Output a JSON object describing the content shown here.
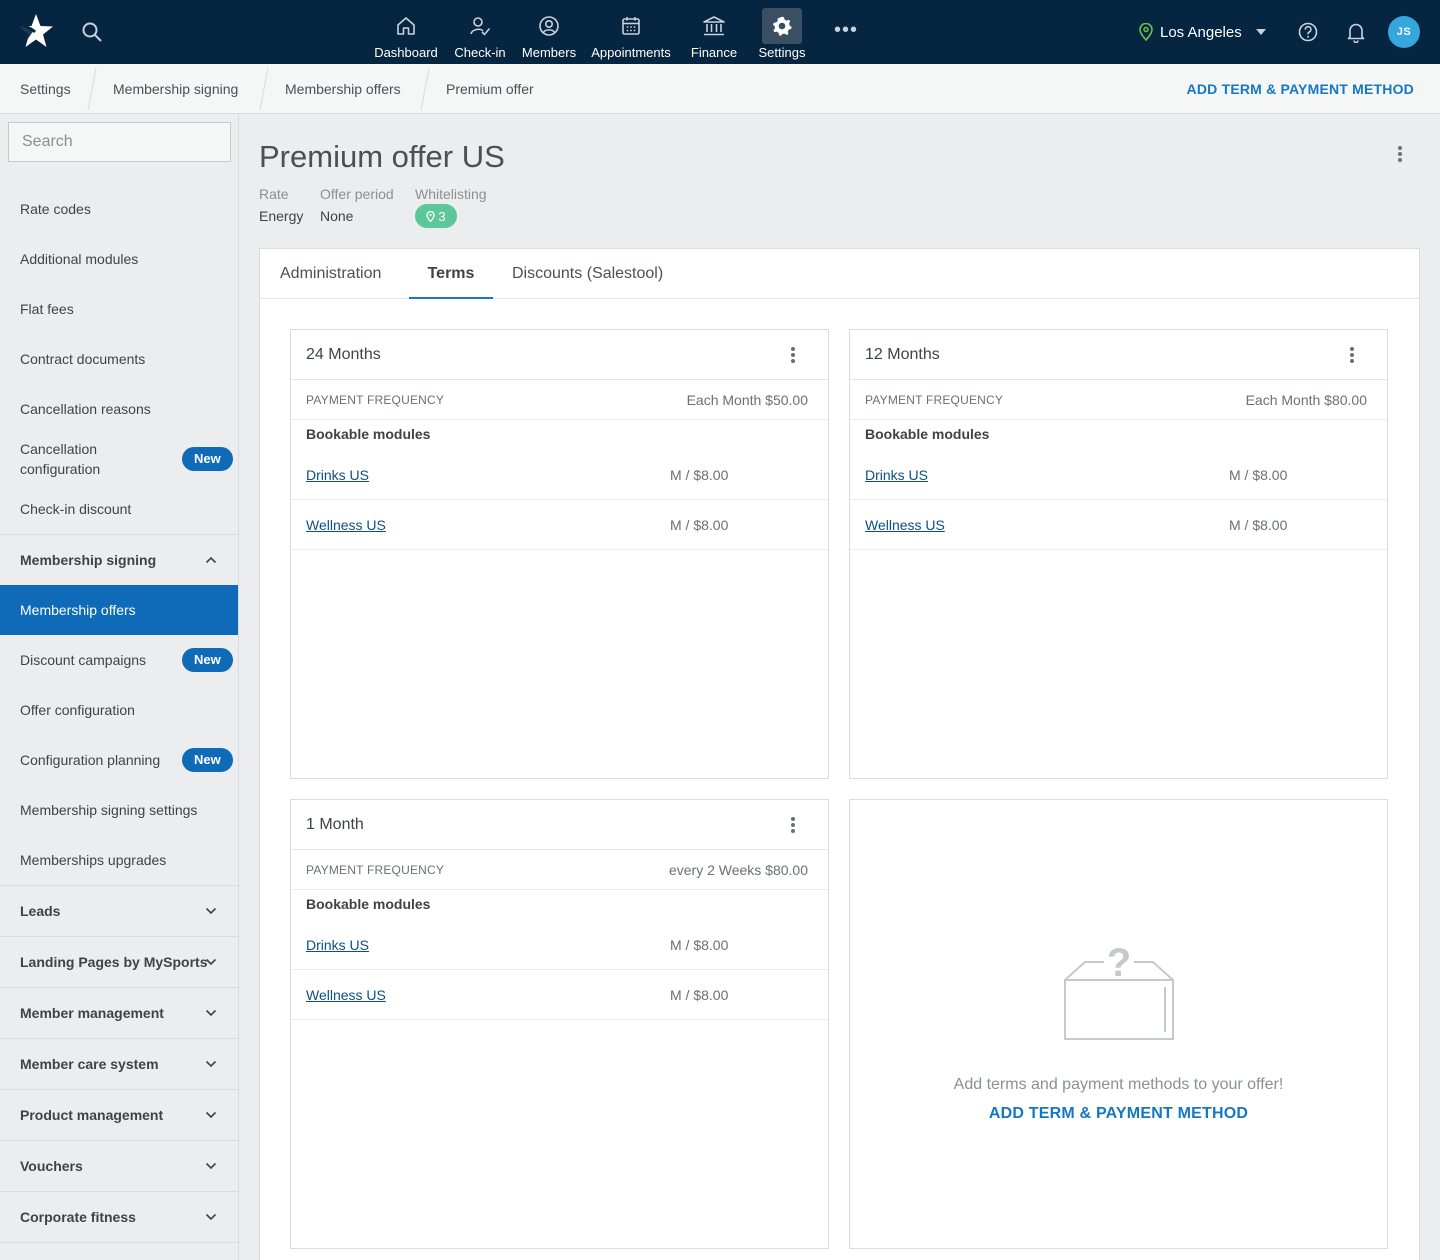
{
  "topnav": {
    "items": [
      {
        "label": "Dashboard",
        "icon": "home-icon"
      },
      {
        "label": "Check-in",
        "icon": "check-in-icon"
      },
      {
        "label": "Members",
        "icon": "members-icon"
      },
      {
        "label": "Appointments",
        "icon": "calendar-icon"
      },
      {
        "label": "Finance",
        "icon": "bank-icon"
      },
      {
        "label": "Settings",
        "icon": "gear-icon",
        "active": true
      }
    ],
    "more": "•••",
    "location": "Los Angeles",
    "avatar_initials": "JS"
  },
  "breadcrumb": {
    "items": [
      "Settings",
      "Membership signing",
      "Membership offers",
      "Premium offer"
    ],
    "action": "ADD TERM & PAYMENT METHOD"
  },
  "sidebar": {
    "search_placeholder": "Search",
    "items": [
      {
        "label": "Rate codes"
      },
      {
        "label": "Additional modules"
      },
      {
        "label": "Flat fees"
      },
      {
        "label": "Contract documents"
      },
      {
        "label": "Cancellation reasons"
      },
      {
        "label": "Cancellation configuration",
        "badge": "New"
      },
      {
        "label": "Check-in discount"
      },
      {
        "label": "Membership signing",
        "group": true,
        "expanded": true
      },
      {
        "label": "Membership offers",
        "active": true
      },
      {
        "label": "Discount campaigns",
        "badge": "New"
      },
      {
        "label": "Offer configuration"
      },
      {
        "label": "Configuration planning",
        "badge": "New"
      },
      {
        "label": "Membership signing settings"
      },
      {
        "label": "Memberships upgrades"
      },
      {
        "label": "Leads",
        "group": true
      },
      {
        "label": "Landing Pages by MySports",
        "group": true
      },
      {
        "label": "Member management",
        "group": true
      },
      {
        "label": "Member care system",
        "group": true
      },
      {
        "label": "Product management",
        "group": true
      },
      {
        "label": "Vouchers",
        "group": true
      },
      {
        "label": "Corporate fitness",
        "group": true
      }
    ]
  },
  "offer": {
    "title": "Premium offer US",
    "meta": {
      "rate_label": "Rate",
      "rate_value": "Energy",
      "period_label": "Offer period",
      "period_value": "None",
      "whitelist_label": "Whitelisting",
      "whitelist_count": "3"
    }
  },
  "tabs": [
    "Administration",
    "Terms",
    "Discounts (Salestool)"
  ],
  "active_tab": "Terms",
  "terms": [
    {
      "title": "24 Months",
      "pf_label": "PAYMENT FREQUENCY",
      "pf_value": "Each Month $50.00",
      "modules_heading": "Bookable modules",
      "modules": [
        {
          "name": "Drinks US",
          "price": "M / $8.00"
        },
        {
          "name": "Wellness US",
          "price": "M / $8.00"
        }
      ]
    },
    {
      "title": "12 Months",
      "pf_label": "PAYMENT FREQUENCY",
      "pf_value": "Each Month $80.00",
      "modules_heading": "Bookable modules",
      "modules": [
        {
          "name": "Drinks US",
          "price": "M / $8.00"
        },
        {
          "name": "Wellness US",
          "price": "M / $8.00"
        }
      ]
    },
    {
      "title": "1 Month",
      "pf_label": "PAYMENT FREQUENCY",
      "pf_value": "every 2 Weeks $80.00",
      "modules_heading": "Bookable modules",
      "modules": [
        {
          "name": "Drinks US",
          "price": "M / $8.00"
        },
        {
          "name": "Wellness US",
          "price": "M / $8.00"
        }
      ]
    }
  ],
  "empty_state": {
    "icon": "question-box-icon",
    "text": "Add terms and payment methods to your offer!",
    "action": "ADD TERM & PAYMENT METHOD"
  },
  "colors": {
    "nav_bg": "#062540",
    "accent": "#1578c2",
    "active_item": "#0f6ab7",
    "whitelist_badge": "#5bc79a",
    "avatar": "#36a6de"
  }
}
